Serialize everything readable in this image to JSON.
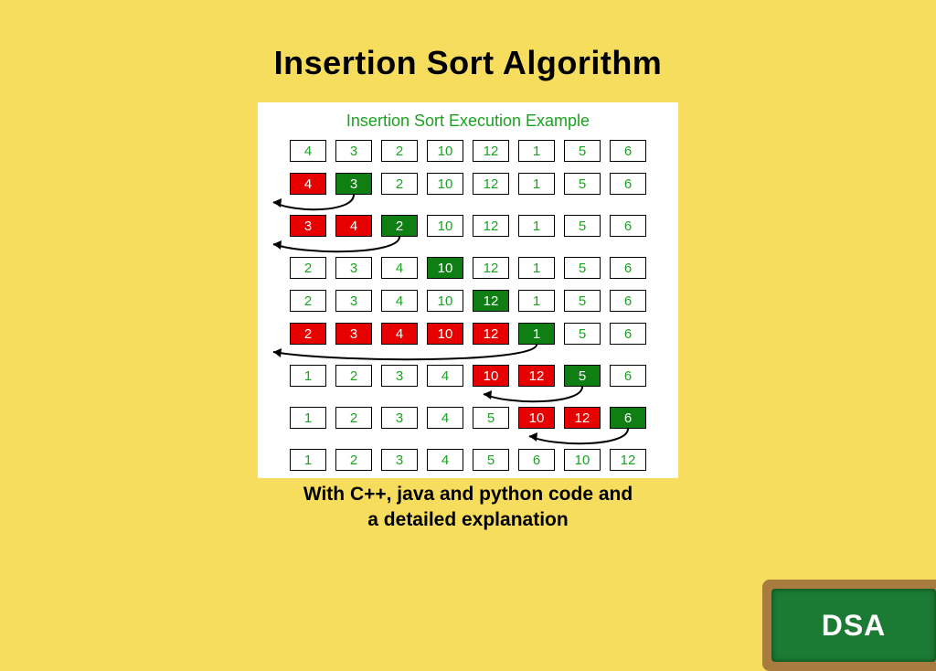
{
  "title": "Insertion Sort Algorithm",
  "panel_title": "Insertion Sort Execution Example",
  "subtitle_line1": "With C++, java and python  code and",
  "subtitle_line2": "a detailed explanation",
  "badge": "DSA",
  "colors": {
    "background": "#f7dd5e",
    "cell_red": "#e60000",
    "cell_green": "#0f7f14",
    "text_green": "#1aa321"
  },
  "chart_data": {
    "type": "table",
    "description": "Insertion sort execution steps. color: w=white/unsorted or sorted plain, r=red shifted, g=green key",
    "rows": [
      {
        "cells": [
          {
            "v": "4",
            "c": "w"
          },
          {
            "v": "3",
            "c": "w"
          },
          {
            "v": "2",
            "c": "w"
          },
          {
            "v": "10",
            "c": "w"
          },
          {
            "v": "12",
            "c": "w"
          },
          {
            "v": "1",
            "c": "w"
          },
          {
            "v": "5",
            "c": "w"
          },
          {
            "v": "6",
            "c": "w"
          }
        ],
        "arrow": null
      },
      {
        "cells": [
          {
            "v": "4",
            "c": "r"
          },
          {
            "v": "3",
            "c": "g"
          },
          {
            "v": "2",
            "c": "w"
          },
          {
            "v": "10",
            "c": "w"
          },
          {
            "v": "12",
            "c": "w"
          },
          {
            "v": "1",
            "c": "w"
          },
          {
            "v": "5",
            "c": "w"
          },
          {
            "v": "6",
            "c": "w"
          }
        ],
        "arrow": {
          "from": 1,
          "to": -1
        }
      },
      {
        "cells": [
          {
            "v": "3",
            "c": "r"
          },
          {
            "v": "4",
            "c": "r"
          },
          {
            "v": "2",
            "c": "g"
          },
          {
            "v": "10",
            "c": "w"
          },
          {
            "v": "12",
            "c": "w"
          },
          {
            "v": "1",
            "c": "w"
          },
          {
            "v": "5",
            "c": "w"
          },
          {
            "v": "6",
            "c": "w"
          }
        ],
        "arrow": {
          "from": 2,
          "to": -1
        }
      },
      {
        "cells": [
          {
            "v": "2",
            "c": "w"
          },
          {
            "v": "3",
            "c": "w"
          },
          {
            "v": "4",
            "c": "w"
          },
          {
            "v": "10",
            "c": "g"
          },
          {
            "v": "12",
            "c": "w"
          },
          {
            "v": "1",
            "c": "w"
          },
          {
            "v": "5",
            "c": "w"
          },
          {
            "v": "6",
            "c": "w"
          }
        ],
        "arrow": null
      },
      {
        "cells": [
          {
            "v": "2",
            "c": "w"
          },
          {
            "v": "3",
            "c": "w"
          },
          {
            "v": "4",
            "c": "w"
          },
          {
            "v": "10",
            "c": "w"
          },
          {
            "v": "12",
            "c": "g"
          },
          {
            "v": "1",
            "c": "w"
          },
          {
            "v": "5",
            "c": "w"
          },
          {
            "v": "6",
            "c": "w"
          }
        ],
        "arrow": null
      },
      {
        "cells": [
          {
            "v": "2",
            "c": "r"
          },
          {
            "v": "3",
            "c": "r"
          },
          {
            "v": "4",
            "c": "r"
          },
          {
            "v": "10",
            "c": "r"
          },
          {
            "v": "12",
            "c": "r"
          },
          {
            "v": "1",
            "c": "g"
          },
          {
            "v": "5",
            "c": "w"
          },
          {
            "v": "6",
            "c": "w"
          }
        ],
        "arrow": {
          "from": 5,
          "to": -1
        }
      },
      {
        "cells": [
          {
            "v": "1",
            "c": "w"
          },
          {
            "v": "2",
            "c": "w"
          },
          {
            "v": "3",
            "c": "w"
          },
          {
            "v": "4",
            "c": "w"
          },
          {
            "v": "10",
            "c": "r"
          },
          {
            "v": "12",
            "c": "r"
          },
          {
            "v": "5",
            "c": "g"
          },
          {
            "v": "6",
            "c": "w"
          }
        ],
        "arrow": {
          "from": 6,
          "to": 4
        }
      },
      {
        "cells": [
          {
            "v": "1",
            "c": "w"
          },
          {
            "v": "2",
            "c": "w"
          },
          {
            "v": "3",
            "c": "w"
          },
          {
            "v": "4",
            "c": "w"
          },
          {
            "v": "5",
            "c": "w"
          },
          {
            "v": "10",
            "c": "r"
          },
          {
            "v": "12",
            "c": "r"
          },
          {
            "v": "6",
            "c": "g"
          }
        ],
        "arrow": {
          "from": 7,
          "to": 5
        }
      },
      {
        "cells": [
          {
            "v": "1",
            "c": "w"
          },
          {
            "v": "2",
            "c": "w"
          },
          {
            "v": "3",
            "c": "w"
          },
          {
            "v": "4",
            "c": "w"
          },
          {
            "v": "5",
            "c": "w"
          },
          {
            "v": "6",
            "c": "w"
          },
          {
            "v": "10",
            "c": "w"
          },
          {
            "v": "12",
            "c": "w"
          }
        ],
        "arrow": null
      }
    ]
  }
}
